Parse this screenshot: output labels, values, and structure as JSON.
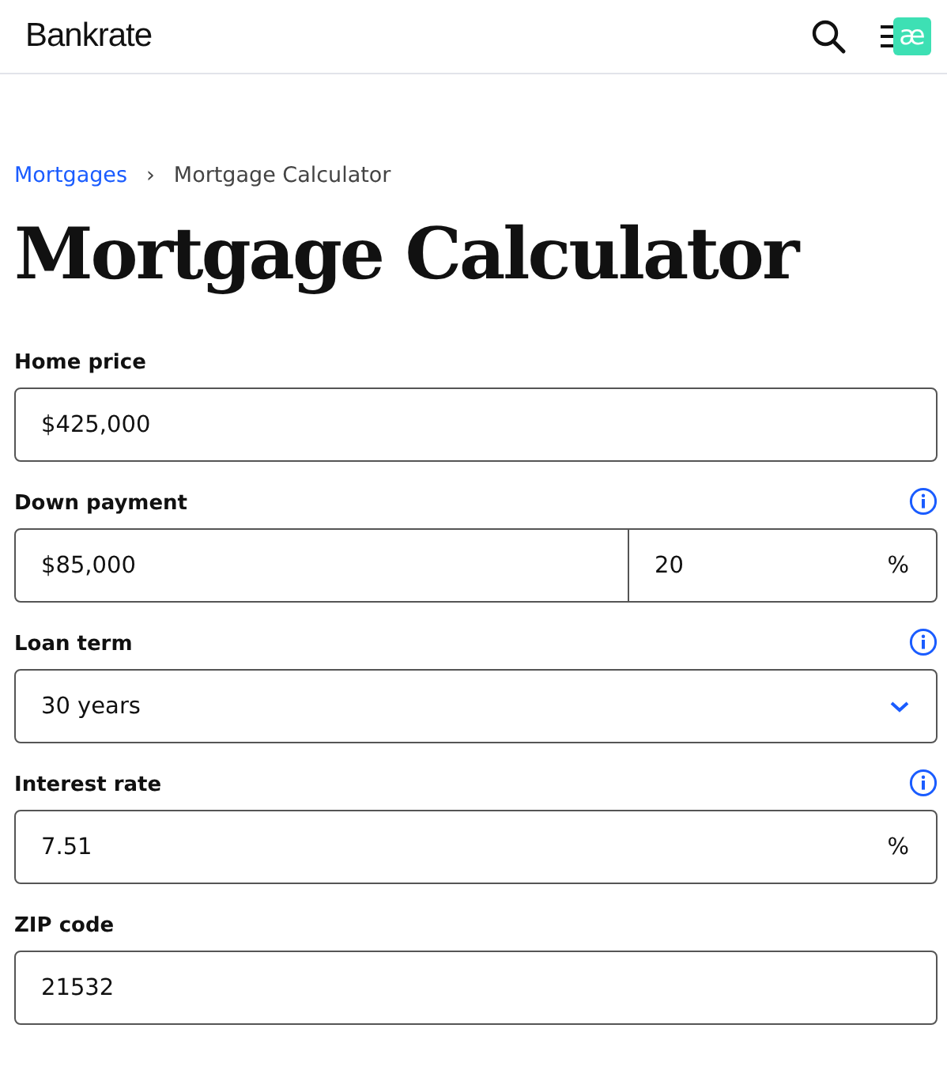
{
  "header": {
    "logo": "Bankrate",
    "badge": "æ"
  },
  "breadcrumb": [
    {
      "label": "Mortgages",
      "link": true
    },
    {
      "label": "›",
      "link": false
    },
    {
      "label": "Mortgage Calculator",
      "link": false
    }
  ],
  "title": "Mortgage Calculator",
  "fields": [
    {
      "label": "Home price",
      "kind": "text",
      "value": "$425,000",
      "info": false
    },
    {
      "label": "Down payment",
      "kind": "split",
      "value": "$85,000",
      "value_2": "20",
      "suffix": "%",
      "info": true
    },
    {
      "label": "Loan term",
      "kind": "select",
      "value": "30 years",
      "info": true
    },
    {
      "label": "Interest rate",
      "kind": "text",
      "value": "7.51",
      "suffix": "%",
      "info": true
    },
    {
      "label": "ZIP code",
      "kind": "text",
      "value": "21532",
      "info": false
    }
  ]
}
